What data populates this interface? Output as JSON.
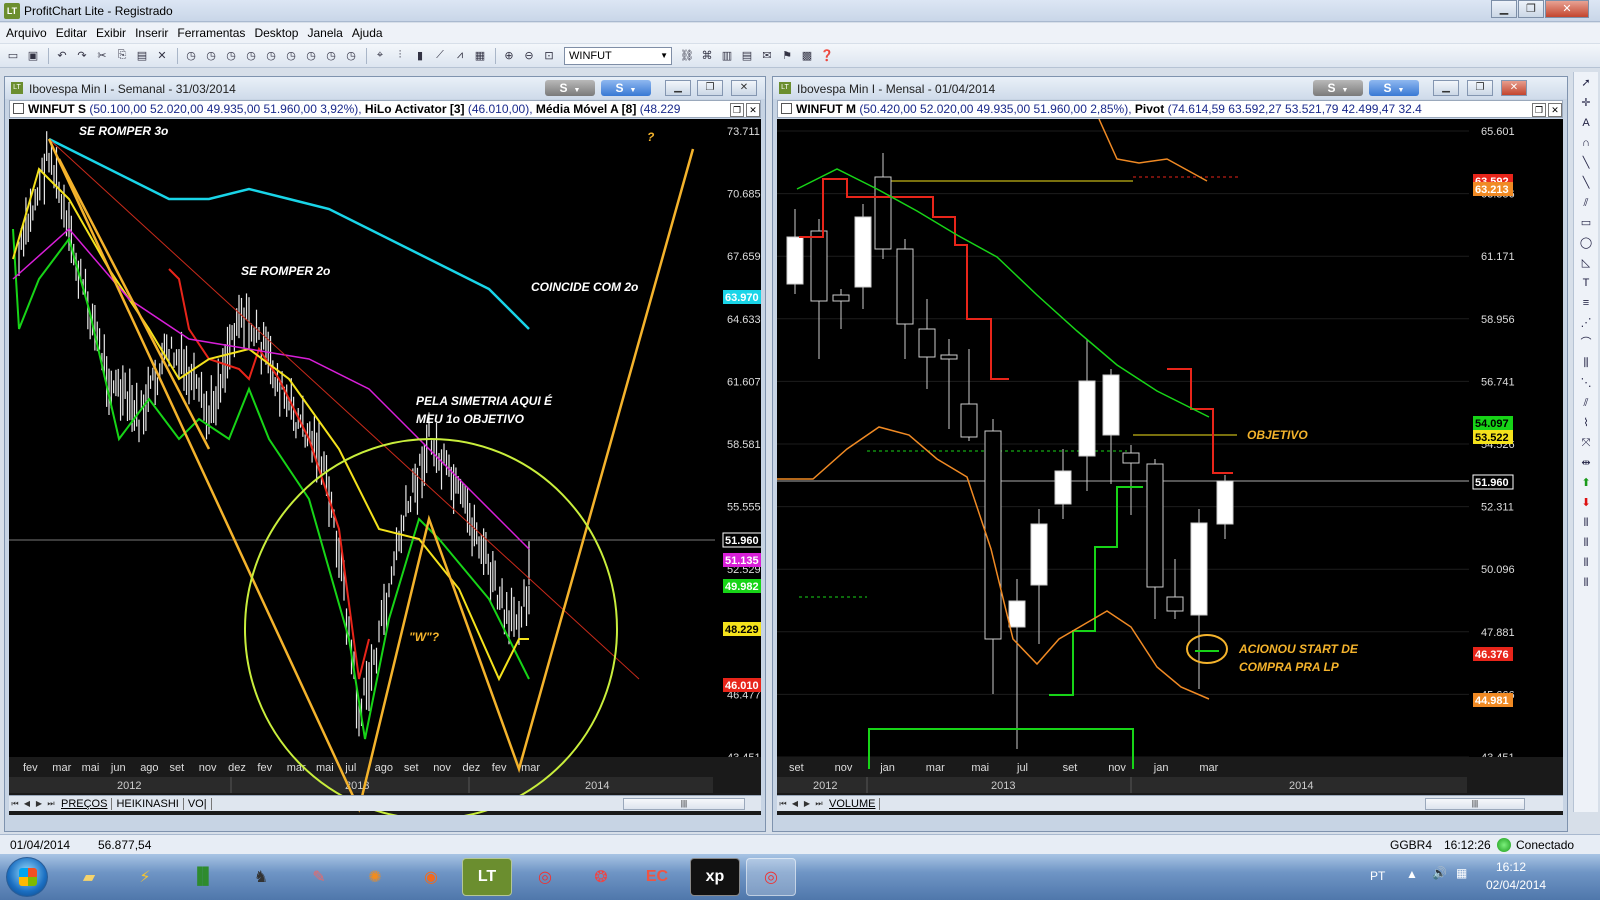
{
  "app": {
    "title": "ProfitChart Lite - Registrado",
    "logo": "LT",
    "window_buttons": [
      "minimize-icon",
      "restore-icon",
      "close-icon"
    ]
  },
  "menu": [
    "Arquivo",
    "Editar",
    "Exibir",
    "Inserir",
    "Ferramentas",
    "Desktop",
    "Janela",
    "Ajuda"
  ],
  "toolbar": {
    "symbol_select": "WINFUT"
  },
  "left_chart": {
    "title": "Ibovespa Min I - Semanal - 31/03/2014",
    "s_button": "S",
    "info": {
      "symbol": "WINFUT S",
      "ohlc": "(50.100,00  52.020,00  49.935,00  51.960,00  3,92%),",
      "hilo": "HiLo Activator [3]",
      "hilo_val": "(46.010,00),",
      "mm": "Média Móvel A [8]",
      "mm_val": "(48.229"
    },
    "price_axis": [
      "73.711",
      "70.685",
      "67.659",
      "64.633",
      "61.607",
      "58.581",
      "55.555",
      "52.529",
      "49.503",
      "46.477",
      "43.451"
    ],
    "badges": [
      {
        "text": "63.970",
        "color": "#19d5e8"
      },
      {
        "text": "51.960",
        "color": "#ffffff"
      },
      {
        "text": "51.135",
        "color": "#d81fd8"
      },
      {
        "text": "49.982",
        "color": "#17d417"
      },
      {
        "text": "48.229",
        "color": "#f4e21c"
      },
      {
        "text": "46.010",
        "color": "#e8251a"
      }
    ],
    "months": [
      "fev",
      "mar",
      "mai",
      "jun",
      "ago",
      "set",
      "nov",
      "dez",
      "fev",
      "mar",
      "mai",
      "jul",
      "ago",
      "set",
      "nov",
      "dez",
      "fev",
      "mar"
    ],
    "years": [
      "2012",
      "2013",
      "2014"
    ],
    "annotations": {
      "a1": "SE ROMPER 3o",
      "a2": "SE ROMPER 2o",
      "a3": "COINCIDE COM 2o",
      "a4_l1": "PELA SIMETRIA AQUI É",
      "a4_l2": "MEU 1o OBJETIVO",
      "a5": "\"W\"?",
      "a6": "?"
    },
    "tabs": [
      "PREÇOS",
      "HEIKINASHI",
      "VO|"
    ]
  },
  "right_chart": {
    "title": "Ibovespa Min I - Mensal - 01/04/2014",
    "s_button": "S",
    "info": {
      "symbol": "WINFUT M",
      "ohlc": "(50.420,00  52.020,00  49.935,00  51.960,00  2,85%),",
      "pivot": "Pivot",
      "pivot_val": "(74.614,59  63.592,27  53.521,79  42.499,47  32.4"
    },
    "price_axis": [
      "65.601",
      "63.386",
      "61.171",
      "58.956",
      "56.741",
      "54.526",
      "52.311",
      "50.096",
      "47.881",
      "45.666",
      "43.451"
    ],
    "badges": [
      {
        "text": "63.592",
        "color": "#e8251a"
      },
      {
        "text": "63.213",
        "color": "#f08a24"
      },
      {
        "text": "54.097",
        "color": "#17d417"
      },
      {
        "text": "53.522",
        "color": "#f4e21c"
      },
      {
        "text": "51.960",
        "color": "#ffffff"
      },
      {
        "text": "46.376",
        "color": "#e8251a"
      },
      {
        "text": "44.981",
        "color": "#f08a24"
      }
    ],
    "months": [
      "set",
      "nov",
      "jan",
      "mar",
      "mai",
      "jul",
      "set",
      "nov",
      "jan",
      "mar"
    ],
    "years": [
      "2012",
      "2013",
      "2014"
    ],
    "annotations": {
      "objetivo": "OBJETIVO",
      "acionou_l1": "ACIONOU START DE",
      "acionou_l2": "COMPRA PRA LP"
    },
    "tabs": [
      "VOLUME"
    ]
  },
  "status": {
    "date": "01/04/2014",
    "value": "56.877,54",
    "ticker": "GGBR4",
    "time": "16:12:26",
    "connection": "Conectado"
  },
  "taskbar": {
    "lang": "PT",
    "clock_time": "16:12",
    "clock_date": "02/04/2014",
    "apps": [
      "explorer-icon",
      "lightning-icon",
      "profitchart-icon",
      "figure-icon",
      "paint-icon",
      "avast-icon",
      "firefox-icon",
      "lt-icon",
      "chrome-icon",
      "circle-app-icon",
      "ec-icon",
      "xp-icon",
      "chrome-icon"
    ]
  }
}
